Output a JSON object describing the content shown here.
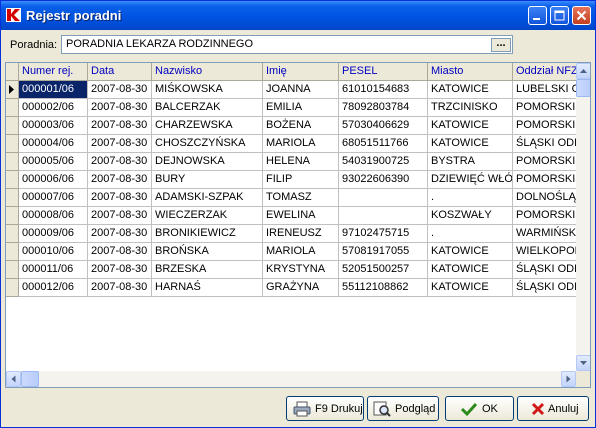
{
  "window": {
    "title": "Rejestr poradni"
  },
  "poradnia": {
    "label": "Poradnia:",
    "value": "PORADNIA LEKARZA RODZINNEGO",
    "browse_label": "..."
  },
  "grid": {
    "columns": [
      "Numer rej.",
      "Data",
      "Nazwisko",
      "Imię",
      "PESEL",
      "Miasto",
      "Oddział NFZ"
    ],
    "rows": [
      [
        "000001/06",
        "2007-08-30",
        "MIŚKOWSKA",
        "JOANNA",
        "61010154683",
        "KATOWICE",
        "LUBELSKI ODDZIAŁ"
      ],
      [
        "000002/06",
        "2007-08-30",
        "BALCERZAK",
        "EMILIA",
        "78092803784",
        "TRZCINISKO",
        "POMORSKI"
      ],
      [
        "000003/06",
        "2007-08-30",
        "CHARZEWSKA",
        "BOŻENA",
        "57030406629",
        "KATOWICE",
        "POMORSKI"
      ],
      [
        "000004/06",
        "2007-08-30",
        "CHOSZCZYŃSKA",
        "MARIOLA",
        "68051511766",
        "KATOWICE",
        "ŚLĄSKI ODDZIAŁ"
      ],
      [
        "000005/06",
        "2007-08-30",
        "DEJNOWSKA",
        "HELENA",
        "54031900725",
        "BYSTRA",
        "POMORSKI"
      ],
      [
        "000006/06",
        "2007-08-30",
        "BURY",
        "FILIP",
        "93022606390",
        "DZIEWIĘĆ WŁÓK",
        "POMORSKI"
      ],
      [
        "000007/06",
        "2007-08-30",
        "ADAMSKI-SZPAK",
        "TOMASZ",
        "",
        ".",
        "DOLNOŚLĄSKI"
      ],
      [
        "000008/06",
        "2007-08-30",
        "WIECZERZAK",
        "EWELINA",
        "",
        "KOSZWAŁY",
        "POMORSKI"
      ],
      [
        "000009/06",
        "2007-08-30",
        "BRONIKIEWICZ",
        "IRENEUSZ",
        "97102475715",
        ".",
        "WARMIŃSKO"
      ],
      [
        "000010/06",
        "2007-08-30",
        "BROŃSKA",
        "MARIOLA",
        "57081917055",
        "KATOWICE",
        "WIELKOPOLSKI"
      ],
      [
        "000011/06",
        "2007-08-30",
        "BRZESKA",
        "KRYSTYNA",
        "52051500257",
        "KATOWICE",
        "ŚLĄSKI ODDZIAŁ"
      ],
      [
        "000012/06",
        "2007-08-30",
        "HARNAŚ",
        "GRAŻYNA",
        "55112108862",
        "KATOWICE",
        "ŚLĄSKI ODDZIAŁ"
      ]
    ],
    "selected_row": 0
  },
  "buttons": {
    "print": "F9 Drukuj",
    "preview": "Podgląd",
    "ok": "OK",
    "cancel": "Anuluj"
  },
  "colors": {
    "title_bar": "#0054e3",
    "header_text": "#0000c0",
    "selection": "#0a246a",
    "close_button": "#c3401f"
  }
}
